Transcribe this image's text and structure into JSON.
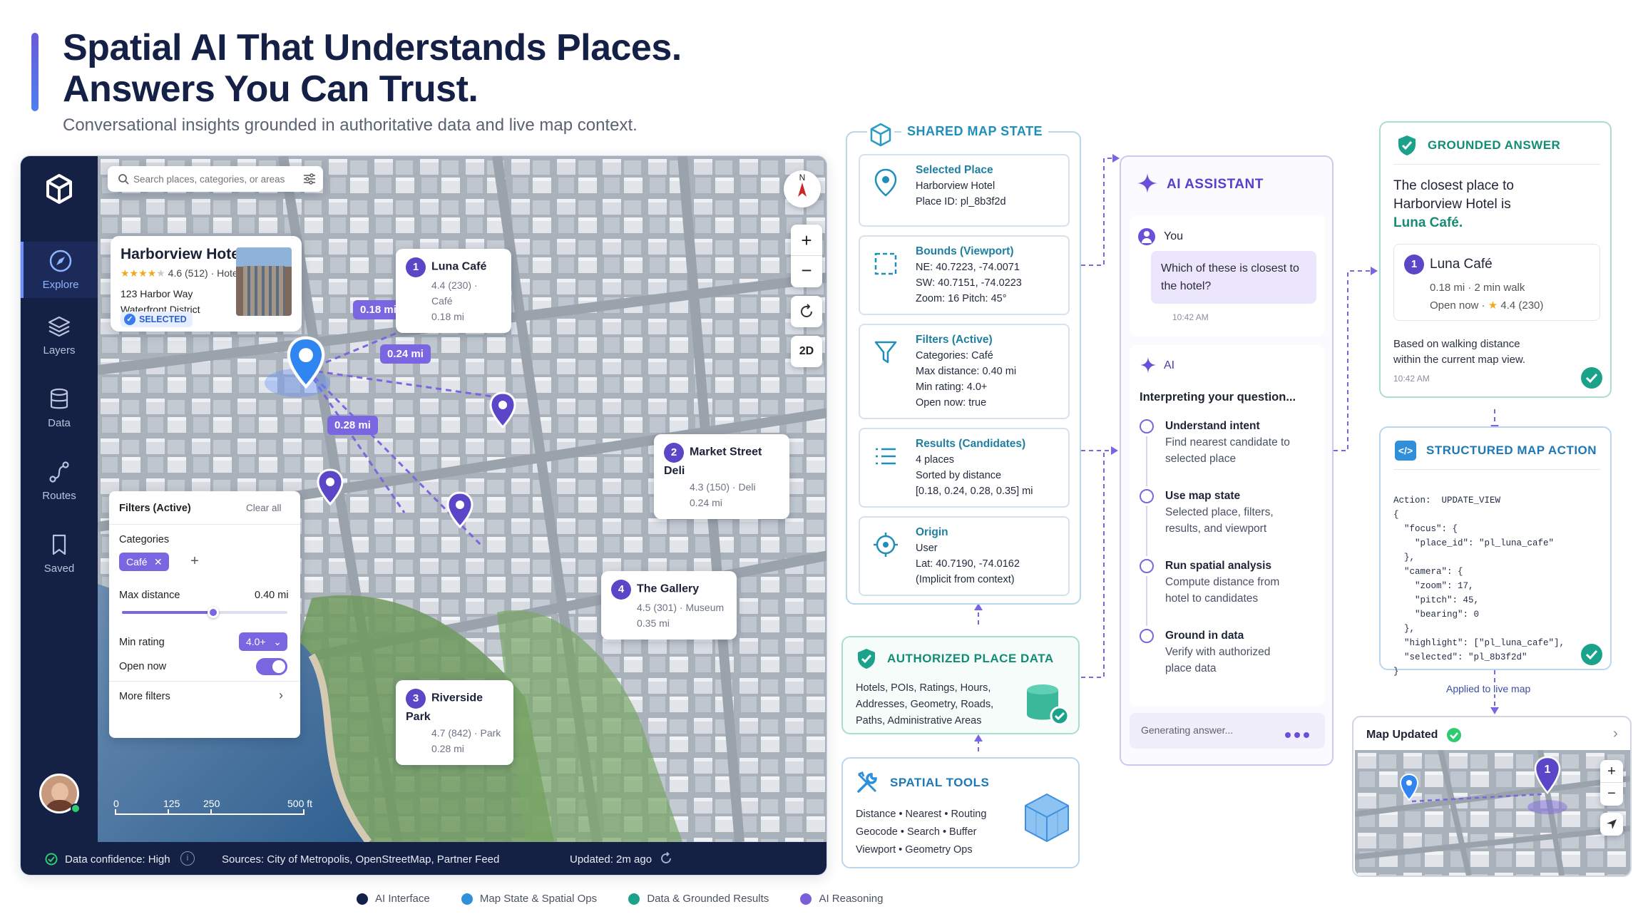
{
  "header": {
    "title_line1": "Spatial AI That Understands Places.",
    "title_line2": "Answers You Can Trust.",
    "subtitle": "Conversational insights grounded in authoritative data and live map context."
  },
  "sidebar": {
    "items": [
      {
        "label": "Explore",
        "icon": "compass-icon",
        "active": true
      },
      {
        "label": "Layers",
        "icon": "layers-icon",
        "active": false
      },
      {
        "label": "Data",
        "icon": "database-icon",
        "active": false
      },
      {
        "label": "Routes",
        "icon": "route-icon",
        "active": false
      },
      {
        "label": "Saved",
        "icon": "bookmark-icon",
        "active": false
      }
    ]
  },
  "search": {
    "placeholder": "Search places, categories, or areas"
  },
  "selected_place_card": {
    "name": "Harborview Hotel",
    "stars": "★★★★",
    "star_empty": "★",
    "rating": "4.6 (512) · Hotel",
    "address_line1": "123 Harbor Way",
    "address_line2": "Waterfront District",
    "badge": "SELECTED"
  },
  "map_controls": {
    "north": "N",
    "zoom_in": "+",
    "zoom_out": "−",
    "mode_2d": "2D"
  },
  "places": [
    {
      "num": "1",
      "name": "Luna Café",
      "meta": "4.4 (230) · Café",
      "dist": "0.18 mi"
    },
    {
      "num": "2",
      "name": "Market Street Deli",
      "meta": "4.3 (150) · Deli",
      "dist": "0.24 mi"
    },
    {
      "num": "3",
      "name": "Riverside Park",
      "meta": "4.7 (842) · Park",
      "dist": "0.28 mi"
    },
    {
      "num": "4",
      "name": "The Gallery",
      "meta": "4.5 (301) · Museum",
      "dist": "0.35 mi"
    }
  ],
  "distance_labels": [
    "0.18 mi",
    "0.24 mi",
    "0.28 mi"
  ],
  "filters_panel": {
    "title": "Filters (Active)",
    "clear": "Clear all",
    "categories_label": "Categories",
    "chip": "Café",
    "max_distance_label": "Max distance",
    "max_distance_value": "0.40 mi",
    "max_distance_fraction": 0.55,
    "min_rating_label": "Min rating",
    "min_rating_value": "4.0+",
    "open_now_label": "Open now",
    "open_now": true,
    "more_filters": "More filters"
  },
  "scale_bar": {
    "ticks": [
      "0",
      "125",
      "250",
      "500 ft"
    ]
  },
  "status_bar": {
    "confidence": "Data confidence: High",
    "sources": "Sources: City of Metropolis, OpenStreetMap, Partner Feed",
    "updated": "Updated: 2m ago"
  },
  "shared_map_state": {
    "title": "SHARED MAP STATE",
    "items": [
      {
        "heading": "Selected Place",
        "lines": [
          "Harborview Hotel",
          "Place ID: pl_8b3f2d"
        ],
        "icon": "location-pin-icon"
      },
      {
        "heading": "Bounds (Viewport)",
        "lines": [
          "NE: 40.7223, -74.0071",
          "SW: 40.7151, -74.0223",
          "Zoom: 16   Pitch: 45°"
        ],
        "icon": "bounds-icon"
      },
      {
        "heading": "Filters (Active)",
        "lines": [
          "Categories: Café",
          "Max distance: 0.40 mi",
          "Min rating: 4.0+",
          "Open now: true"
        ],
        "icon": "funnel-icon"
      },
      {
        "heading": "Results (Candidates)",
        "lines": [
          "4 places",
          "Sorted by distance",
          "[0.18, 0.24, 0.28, 0.35] mi"
        ],
        "icon": "list-icon"
      },
      {
        "heading": "Origin",
        "lines": [
          "User",
          "Lat: 40.7190, -74.0162",
          "(Implicit from context)"
        ],
        "icon": "crosshair-icon"
      }
    ]
  },
  "authorized_data": {
    "title": "AUTHORIZED PLACE DATA",
    "lines": [
      "Hotels, POIs, Ratings, Hours,",
      "Addresses, Geometry, Roads,",
      "Paths, Administrative Areas"
    ]
  },
  "spatial_tools": {
    "title": "SPATIAL TOOLS",
    "lines": [
      "Distance  •  Nearest  •  Routing",
      "Geocode  •  Search  •  Buffer",
      "Viewport  •  Geometry Ops"
    ]
  },
  "assistant": {
    "title": "AI ASSISTANT",
    "user_label": "You",
    "user_message": "Which of these is closest to the hotel?",
    "user_time": "10:42 AM",
    "ai_label": "AI",
    "interpreting": "Interpreting your question...",
    "steps": [
      {
        "title": "Understand intent",
        "desc": "Find nearest candidate to selected place"
      },
      {
        "title": "Use map state",
        "desc": "Selected place, filters, results, and viewport"
      },
      {
        "title": "Run spatial analysis",
        "desc": "Compute distance from hotel to candidates"
      },
      {
        "title": "Ground in data",
        "desc": "Verify with authorized place data"
      }
    ],
    "generating": "Generating answer..."
  },
  "grounded_answer": {
    "title": "GROUNDED ANSWER",
    "line1": "The closest place to",
    "line2": "Harborview Hotel is",
    "answer": "Luna Café.",
    "result_num": "1",
    "result_name": "Luna Café",
    "result_meta": "0.18 mi  ·  2 min walk",
    "result_open": "Open now  ·",
    "result_rating": "4.4 (230)",
    "basis_line1": "Based on walking distance",
    "basis_line2": "within the current map view.",
    "time": "10:42 AM"
  },
  "structured_action": {
    "title": "STRUCTURED MAP ACTION",
    "code": [
      "Action:  UPDATE_VIEW",
      "{",
      "  \"focus\": {",
      "    \"place_id\": \"pl_luna_cafe\"",
      "  },",
      "  \"camera\": {",
      "    \"zoom\": 17,",
      "    \"pitch\": 45,",
      "    \"bearing\": 0",
      "  },",
      "  \"highlight\": [\"pl_luna_cafe\"],",
      "  \"selected\": \"pl_8b3f2d\"",
      "}"
    ]
  },
  "applied_label": "Applied to live map",
  "map_updated": {
    "title": "Map Updated",
    "zoom_in": "+",
    "zoom_out": "−"
  },
  "legend": [
    {
      "label": "AI Interface",
      "color": "#15204a"
    },
    {
      "label": "Map State & Spatial Ops",
      "color": "#2f8fd8"
    },
    {
      "label": "Data & Grounded Results",
      "color": "#1aa38a"
    },
    {
      "label": "AI Reasoning",
      "color": "#7a5fd8"
    }
  ]
}
